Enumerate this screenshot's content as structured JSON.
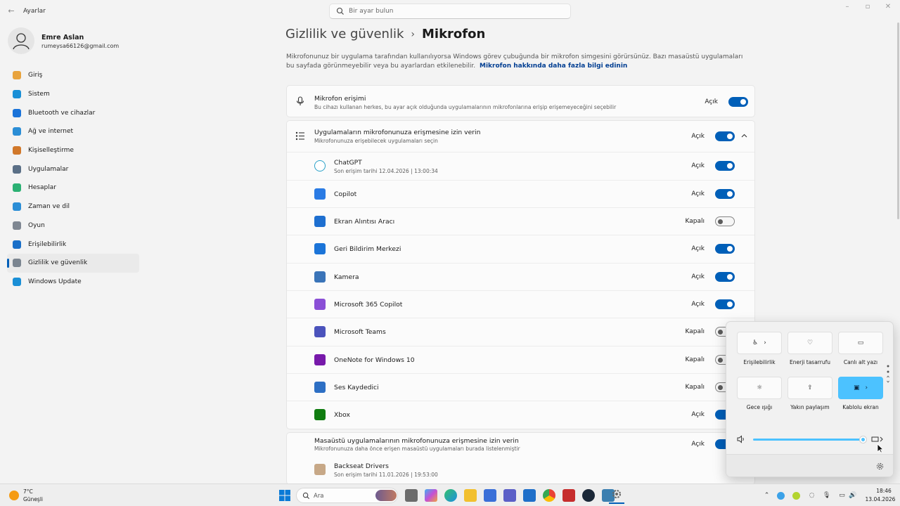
{
  "window": {
    "title": "Ayarlar",
    "search_placeholder": "Bir ayar bulun"
  },
  "user": {
    "name": "Emre Aslan",
    "email": "rumeysa66126@gmail.com"
  },
  "nav": [
    {
      "label": "Giriş",
      "icon": "home-icon",
      "color": "#e8a33d"
    },
    {
      "label": "Sistem",
      "icon": "system-icon",
      "color": "#1a8fd6"
    },
    {
      "label": "Bluetooth ve cihazlar",
      "icon": "bluetooth-icon",
      "color": "#1a73d9"
    },
    {
      "label": "Ağ ve internet",
      "icon": "network-icon",
      "color": "#2b8ed6"
    },
    {
      "label": "Kişiselleştirme",
      "icon": "brush-icon",
      "color": "#d1782a"
    },
    {
      "label": "Uygulamalar",
      "icon": "apps-icon",
      "color": "#5a6f86"
    },
    {
      "label": "Hesaplar",
      "icon": "accounts-icon",
      "color": "#2bb073"
    },
    {
      "label": "Zaman ve dil",
      "icon": "globe-icon",
      "color": "#2b8ed6"
    },
    {
      "label": "Oyun",
      "icon": "gamepad-icon",
      "color": "#7f8792"
    },
    {
      "label": "Erişilebilirlik",
      "icon": "accessibility-icon",
      "color": "#1a6fc8"
    },
    {
      "label": "Gizlilik ve güvenlik",
      "icon": "shield-icon",
      "color": "#7b8590",
      "active": true
    },
    {
      "label": "Windows Update",
      "icon": "update-icon",
      "color": "#1a8fd6"
    }
  ],
  "header": {
    "parent": "Gizlilik ve güvenlik",
    "separator": "›",
    "current": "Mikrofon",
    "description": "Mikrofonunuz bir uygulama tarafından kullanılıyorsa Windows görev çubuğunda bir mikrofon simgesini görürsünüz. Bazı masaüstü uygulamaları bu sayfada görünmeyebilir veya bu ayarlardan etkilenebilir.",
    "link": "Mikrofon hakkında daha fazla bilgi edinin"
  },
  "mic_access": {
    "title": "Mikrofon erişimi",
    "subtitle": "Bu cihazı kullanan herkes, bu ayar açık olduğunda uygulamalarının mikrofonlarına erişip erişemeyeceğini seçebilir",
    "state": "Açık"
  },
  "app_access": {
    "title": "Uygulamaların mikrofonunuza erişmesine izin verin",
    "subtitle": "Mikrofonunuza erişebilecek uygulamaları seçin",
    "state": "Açık",
    "apps": [
      {
        "name": "ChatGPT",
        "sub": "Son erişim tarihi 12.04.2026  |  13:00:34",
        "state": "Açık",
        "on": true,
        "icon": "chatgpt-icon"
      },
      {
        "name": "Copilot",
        "sub": "",
        "state": "Açık",
        "on": true,
        "icon": "copilot-icon"
      },
      {
        "name": "Ekran Alıntısı Aracı",
        "sub": "",
        "state": "Kapalı",
        "on": false,
        "icon": "snipping-tool-icon"
      },
      {
        "name": "Geri Bildirim Merkezi",
        "sub": "",
        "state": "Açık",
        "on": true,
        "icon": "feedback-hub-icon"
      },
      {
        "name": "Kamera",
        "sub": "",
        "state": "Açık",
        "on": true,
        "icon": "camera-icon"
      },
      {
        "name": "Microsoft 365 Copilot",
        "sub": "",
        "state": "Açık",
        "on": true,
        "icon": "m365-copilot-icon"
      },
      {
        "name": "Microsoft Teams",
        "sub": "",
        "state": "Kapalı",
        "on": false,
        "icon": "teams-icon"
      },
      {
        "name": "OneNote for Windows 10",
        "sub": "",
        "state": "Kapalı",
        "on": false,
        "icon": "onenote-icon"
      },
      {
        "name": "Ses Kaydedici",
        "sub": "",
        "state": "Kapalı",
        "on": false,
        "icon": "voice-recorder-icon"
      },
      {
        "name": "Xbox",
        "sub": "",
        "state": "Açık",
        "on": true,
        "icon": "xbox-icon"
      }
    ]
  },
  "desktop_access": {
    "title": "Masaüstü uygulamalarının mikrofonunuza erişmesine izin verin",
    "subtitle": "Mikrofonunuza daha önce erişen masaüstü uygulamaları burada listelenmiştir",
    "state": "Açık",
    "app_name": "Backseat Drivers",
    "app_sub": "Son erişim tarihi 11.01.2026  |  19:53:00"
  },
  "quick_settings": {
    "tiles": [
      {
        "label": "Erişilebilirlik",
        "icon": "accessibility-icon",
        "on": false,
        "chevron": true
      },
      {
        "label": "Enerji tasarrufu",
        "icon": "energy-saver-icon",
        "on": false,
        "chevron": false
      },
      {
        "label": "Canlı alt yazı",
        "icon": "captions-icon",
        "on": false,
        "chevron": false
      },
      {
        "label": "Gece ışığı",
        "icon": "night-light-icon",
        "on": false,
        "chevron": false
      },
      {
        "label": "Yakın paylaşım",
        "icon": "share-icon",
        "on": false,
        "chevron": false
      },
      {
        "label": "Kablolu ekran",
        "icon": "cast-icon",
        "on": true,
        "chevron": true
      }
    ],
    "volume_percent": 100
  },
  "taskbar": {
    "temperature": "7°C",
    "weather": "Güneşli",
    "search_placeholder": "Ara",
    "time": "18:46",
    "date": "13.04.2026"
  },
  "colors": {
    "accent": "#005fb8",
    "quick_accent": "#4cc2ff"
  }
}
